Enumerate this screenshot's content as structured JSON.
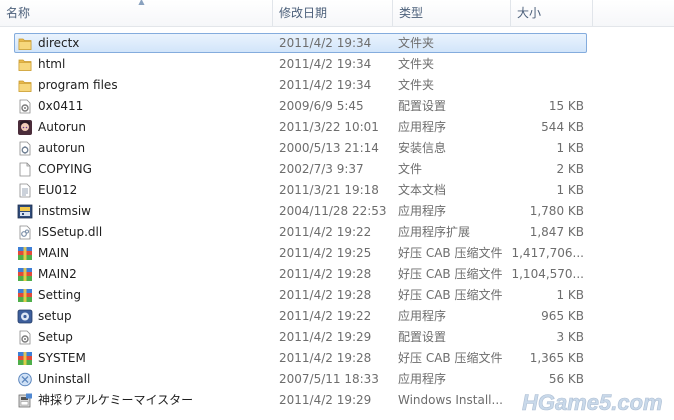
{
  "columns": {
    "name": "名称",
    "date": "修改日期",
    "type": "类型",
    "size": "大小"
  },
  "files": [
    {
      "name": "directx",
      "date": "2011/4/2 19:34",
      "type": "文件夹",
      "size": "",
      "icon": "folder-icon",
      "selected": true
    },
    {
      "name": "html",
      "date": "2011/4/2 19:34",
      "type": "文件夹",
      "size": "",
      "icon": "folder-icon"
    },
    {
      "name": "program files",
      "date": "2011/4/2 19:34",
      "type": "文件夹",
      "size": "",
      "icon": "folder-icon"
    },
    {
      "name": "0x0411",
      "date": "2009/6/9 5:45",
      "type": "配置设置",
      "size": "15 KB",
      "icon": "settings-file-icon"
    },
    {
      "name": "Autorun",
      "date": "2011/3/22 10:01",
      "type": "应用程序",
      "size": "544 KB",
      "icon": "anime-app-icon"
    },
    {
      "name": "autorun",
      "date": "2000/5/13 21:14",
      "type": "安装信息",
      "size": "1 KB",
      "icon": "setup-info-icon"
    },
    {
      "name": "COPYING",
      "date": "2002/7/3 9:37",
      "type": "文件",
      "size": "2 KB",
      "icon": "blank-file-icon"
    },
    {
      "name": "EU012",
      "date": "2011/3/21 19:18",
      "type": "文本文档",
      "size": "1 KB",
      "icon": "text-file-icon"
    },
    {
      "name": "instmsiw",
      "date": "2004/11/28 22:53",
      "type": "应用程序",
      "size": "1,780 KB",
      "icon": "installer-app-icon"
    },
    {
      "name": "ISSetup.dll",
      "date": "2011/4/2 19:22",
      "type": "应用程序扩展",
      "size": "1,847 KB",
      "icon": "dll-file-icon"
    },
    {
      "name": "MAIN",
      "date": "2011/4/2 19:25",
      "type": "好压 CAB 压缩文件",
      "size": "1,417,706...",
      "icon": "archive-icon"
    },
    {
      "name": "MAIN2",
      "date": "2011/4/2 19:28",
      "type": "好压 CAB 压缩文件",
      "size": "1,104,570...",
      "icon": "archive-icon"
    },
    {
      "name": "Setting",
      "date": "2011/4/2 19:28",
      "type": "好压 CAB 压缩文件",
      "size": "1 KB",
      "icon": "archive-icon"
    },
    {
      "name": "setup",
      "date": "2011/4/2 19:22",
      "type": "应用程序",
      "size": "965 KB",
      "icon": "setup-app-icon"
    },
    {
      "name": "Setup",
      "date": "2011/4/2 19:29",
      "type": "配置设置",
      "size": "3 KB",
      "icon": "settings-file-icon"
    },
    {
      "name": "SYSTEM",
      "date": "2011/4/2 19:28",
      "type": "好压 CAB 压缩文件",
      "size": "1,365 KB",
      "icon": "archive-icon"
    },
    {
      "name": "Uninstall",
      "date": "2007/5/11 18:33",
      "type": "应用程序",
      "size": "56 KB",
      "icon": "uninstall-app-icon"
    },
    {
      "name": "神採りアルケミーマイスター",
      "date": "2011/4/2 19:29",
      "type": "Windows Install...",
      "size": "",
      "icon": "msi-installer-icon"
    }
  ],
  "watermark": "HGame5.com"
}
